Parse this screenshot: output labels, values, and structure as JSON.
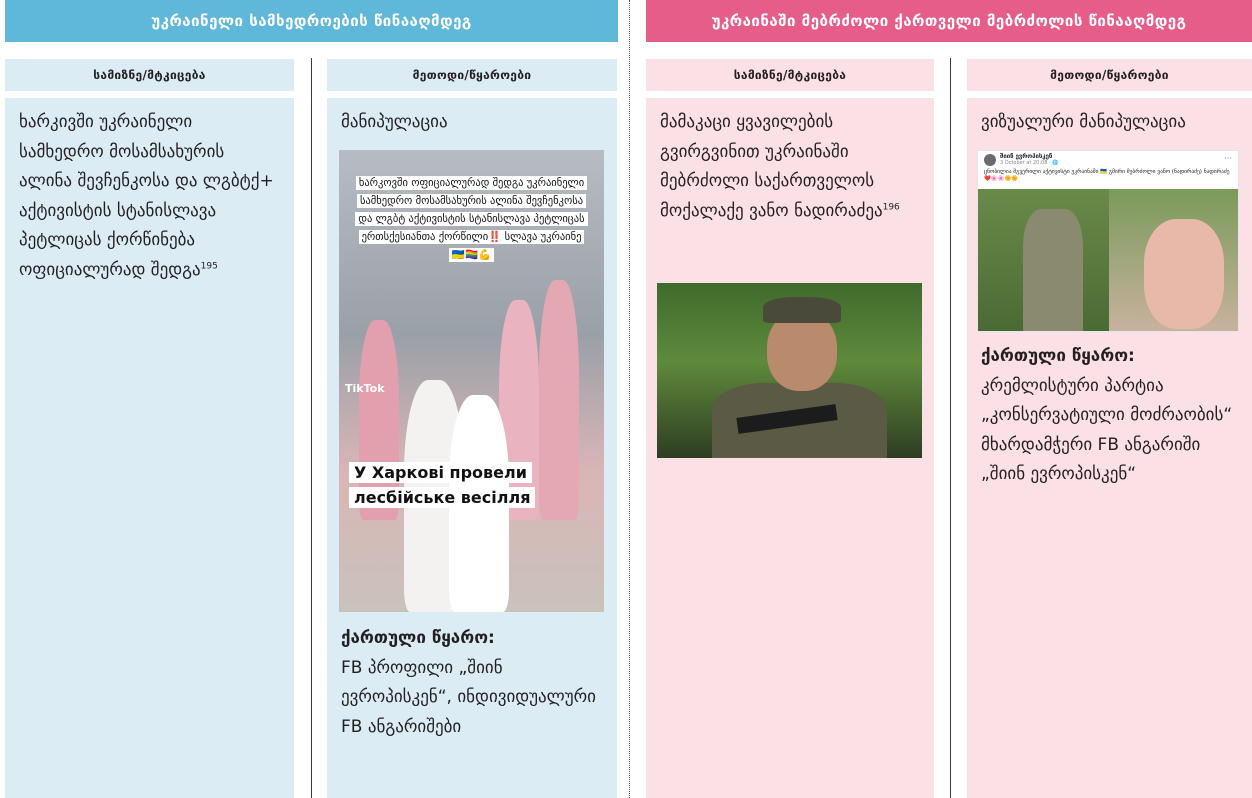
{
  "colors": {
    "left_header": "#5fb8d9",
    "right_header": "#e75d8a",
    "left_col_bg": "#dbecf5",
    "right_col_bg": "#fbe0e6"
  },
  "headers": {
    "left": "უკრაინელი სამხედროების წინააღმდეგ",
    "right": "უკრაინაში მებრძოლი ქართველი მებრძოლის წინააღმდეგ"
  },
  "subheaders": {
    "c1": "სამიზნე/მტკიცება",
    "c2": "მეთოდი/წყაროები",
    "c3": "სამიზნე/მტკიცება",
    "c4": "მეთოდი/წყაროები"
  },
  "col1": {
    "text": "ხარკივში უკრაინელი სამხედრო მოსამსახურის ალინა შევჩენკოსა და ლგბტქ+ აქტივისტის სტანისლავა პეტლიცას ქორწინება ოფიციალურად შედგა",
    "footnote": "195"
  },
  "col2": {
    "method": "მანიპულაცია",
    "image_caption_top": "ხარკოვში ოფიციალურად შედგა უკრაინელი სამხედრო მოსამსახურის ალინა შევჩენკოსა და ლგბტ აქტივისტის სტანისლავა პეტლიცას ერთსქესიანთა ქორწილი‼️ სლავა უკრაინე🇺🇦🏳️‍🌈💪",
    "image_caption_bottom": "У Харкові провели лесбійське весілля",
    "image_watermark": "TikTok",
    "source_label": "ქართული წყარო:",
    "source_text": "FB პროფილი „შიინ ევროპისკენ“, ინდივიდუალური FB ანგარიშები"
  },
  "col3": {
    "text": "მამაკაცი ყვავილების გვირგვინით უკრაინაში მებრძოლი საქართველოს მოქალაქე ვანო ნადირაძეა",
    "footnote": "196"
  },
  "col4": {
    "method": "ვიზუალური მანიპულაცია",
    "post_name": "შიინ ევროპისკენ",
    "post_date": "3 October at 20:08 · 🌐",
    "post_text": "ცნობილია მგვერილი აქტივისტი უკრაინაში 🇺🇦 გმირი მებრძოლი ვანო (ნადირაძე) ნადირაძე ❤️🌸🌸🌼🌼",
    "source_label": "ქართული წყარო:",
    "source_text": "კრემლისტური პარტია „კონსერვატიული მოძრაობის“ მხარდამჭერი FB ანგარიში „შიინ ევროპისკენ“"
  }
}
